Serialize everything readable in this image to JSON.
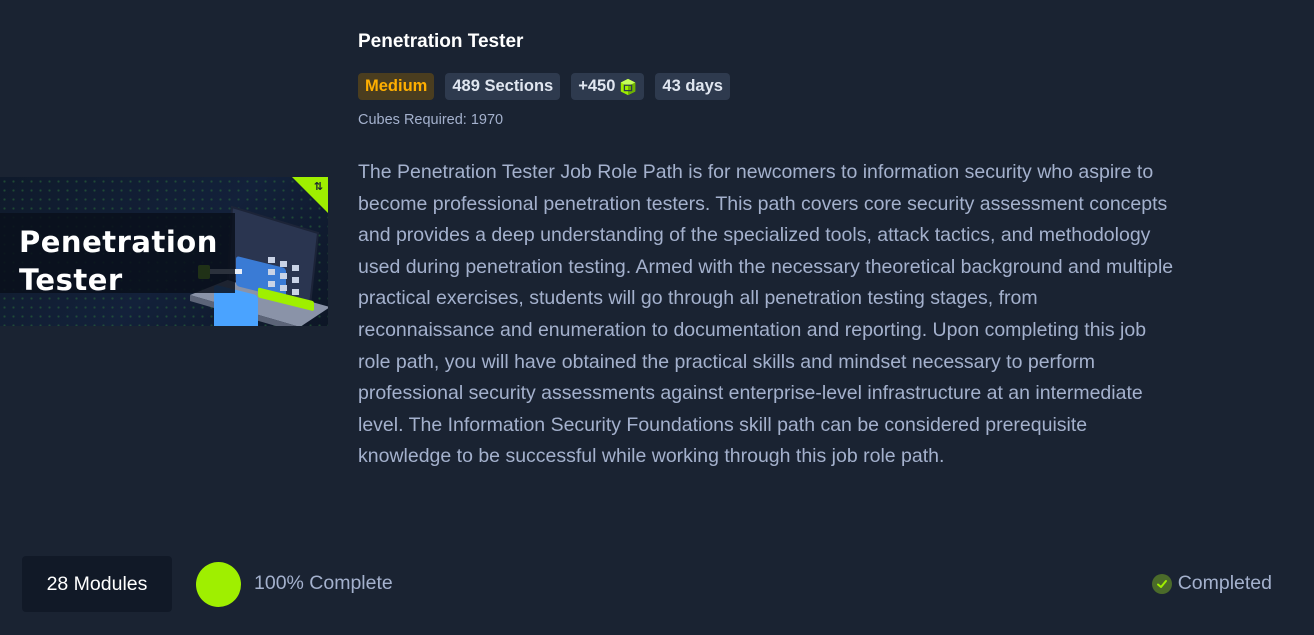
{
  "thumbnail": {
    "line1": "Penetration",
    "line2": "Tester",
    "corner_icon": "merge-icon"
  },
  "path": {
    "title": "Penetration Tester",
    "difficulty": "Medium",
    "sections": "489 Sections",
    "cubes_reward": "+450",
    "duration": "43 days",
    "cubes_required": "Cubes Required: 1970",
    "description": "The Penetration Tester Job Role Path is for newcomers to information security who aspire to become professional penetration testers. This path covers core security assessment concepts and provides a deep understanding of the specialized tools, attack tactics, and methodology used during penetration testing. Armed with the necessary theoretical background and multiple practical exercises, students will go through all penetration testing stages, from reconnaissance and enumeration to documentation and reporting. Upon completing this job role path, you will have obtained the practical skills and mindset necessary to perform professional security assessments against enterprise-level infrastructure at an intermediate level. The Information Security Foundations skill path can be considered prerequisite knowledge to be successful while working through this job role path."
  },
  "footer": {
    "modules": "28 Modules",
    "progress_percent": 100,
    "progress_text": "100% Complete",
    "status": "Completed"
  },
  "colors": {
    "background": "#1a2332",
    "accent": "#9fef00",
    "medium": "#ffaf00"
  }
}
